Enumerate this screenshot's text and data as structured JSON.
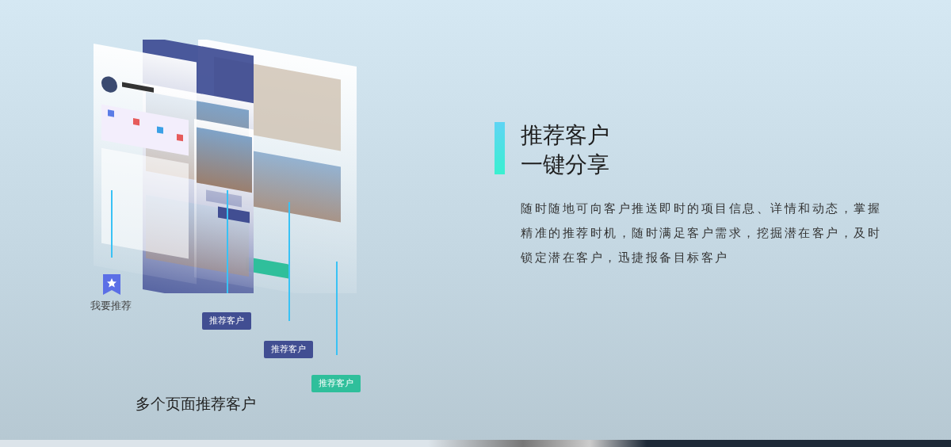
{
  "illustration": {
    "icon_label": "我要推荐",
    "tags": [
      {
        "label": "推荐客户",
        "color": "#414e92"
      },
      {
        "label": "推荐客户",
        "color": "#414e92"
      },
      {
        "label": "推荐客户",
        "color": "#2fbf9b"
      }
    ],
    "caption": "多个页面推荐客户"
  },
  "feature": {
    "title_lines": [
      "推荐客户",
      "一键分享"
    ],
    "description": "随时随地可向客户推送即时的项目信息、详情和动态，掌握精准的推荐时机，随时满足客户需求，挖掘潜在客户，及时锁定潜在客户，迅捷报备目标客户"
  }
}
